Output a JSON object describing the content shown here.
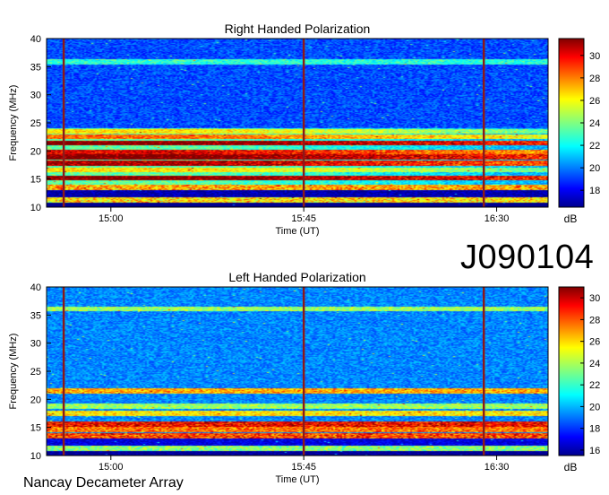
{
  "observation_id": "J090104",
  "footer": "Nancay Decameter Array",
  "colors": {
    "colormap": [
      "#00008f",
      "#0000ff",
      "#0080ff",
      "#00ffff",
      "#80ff80",
      "#ffff00",
      "#ff8000",
      "#ff0000",
      "#800000"
    ],
    "marker_line": "#8b1a1a"
  },
  "chart_data": [
    {
      "type": "heatmap",
      "title": "Right Handed Polarization",
      "xlabel": "Time (UT)",
      "ylabel": "Frequency (MHz)",
      "xticks": [
        "15:00",
        "15:45",
        "16:30"
      ],
      "yticks": [
        10,
        15,
        20,
        25,
        30,
        35,
        40
      ],
      "ylim": [
        10,
        40
      ],
      "colorbar": {
        "label": "dB",
        "ticks": [
          18,
          20,
          22,
          24,
          26,
          28,
          30
        ],
        "range": [
          16.5,
          31.5
        ]
      },
      "vertical_markers_minutes": [
        -11,
        45,
        87
      ],
      "bands": [
        {
          "f": 11.3,
          "db": 27
        },
        {
          "f": 13.5,
          "db": 28
        },
        {
          "f": 15.2,
          "db": 30
        },
        {
          "f": 16.6,
          "db": 24
        },
        {
          "f": 17.8,
          "db": 29
        },
        {
          "f": 18.9,
          "db": 30
        },
        {
          "f": 19.8,
          "db": 28
        },
        {
          "f": 21.4,
          "db": 30
        },
        {
          "f": 22.5,
          "db": 26
        },
        {
          "f": 23.5,
          "db": 24
        },
        {
          "f": 35.9,
          "db": 23
        }
      ]
    },
    {
      "type": "heatmap",
      "title": "Left Handed Polarization",
      "xlabel": "Time (UT)",
      "ylabel": "Frequency (MHz)",
      "xticks": [
        "15:00",
        "15:45",
        "16:30"
      ],
      "yticks": [
        10,
        15,
        20,
        25,
        30,
        35,
        40
      ],
      "ylim": [
        10,
        40
      ],
      "colorbar": {
        "label": "dB",
        "ticks": [
          16,
          18,
          20,
          22,
          24,
          26,
          28,
          30
        ],
        "range": [
          15.5,
          31
        ]
      },
      "vertical_markers_minutes": [
        -11,
        45,
        87
      ],
      "bands": [
        {
          "f": 11.3,
          "db": 24
        },
        {
          "f": 13.5,
          "db": 29
        },
        {
          "f": 14.6,
          "db": 28
        },
        {
          "f": 15.6,
          "db": 30
        },
        {
          "f": 17.5,
          "db": 26
        },
        {
          "f": 18.8,
          "db": 24
        },
        {
          "f": 21.5,
          "db": 27
        },
        {
          "f": 36.1,
          "db": 24
        }
      ]
    }
  ]
}
